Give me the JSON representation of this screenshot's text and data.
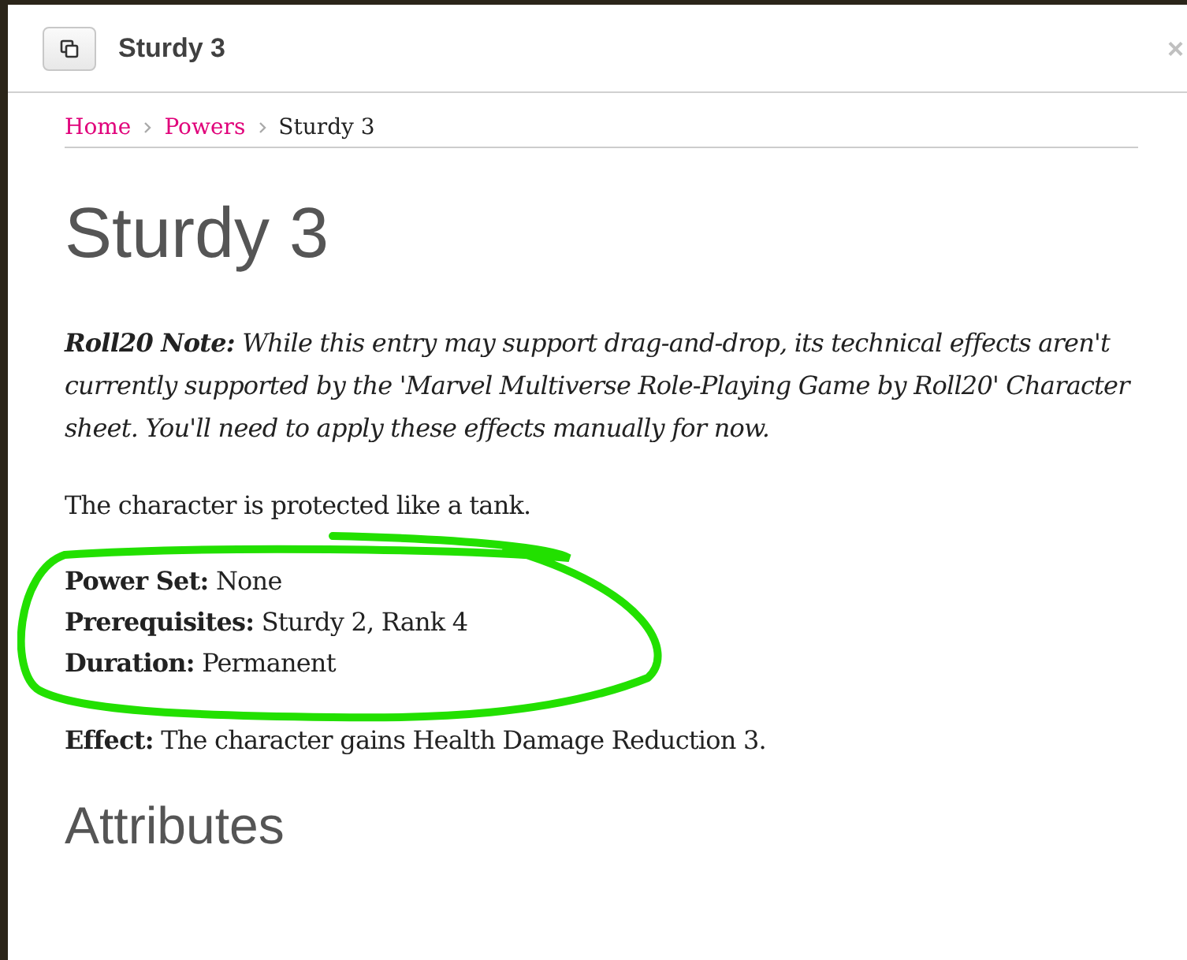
{
  "dialog": {
    "title": "Sturdy 3",
    "close": "×"
  },
  "breadcrumb": [
    {
      "label": "Home",
      "link": true
    },
    {
      "label": "Powers",
      "link": true
    },
    {
      "label": "Sturdy 3",
      "link": false
    }
  ],
  "heading": "Sturdy 3",
  "note": "**Roll20 Note:** While this entry may support drag-and-drop, its technical effects aren't currently supported by the 'Marvel Multiverse Role-Playing Game by Roll20' Character sheet. You'll need to apply these effects manually for now.",
  "description": "The character is protected like a tank.",
  "properties": [
    {
      "label": "Power Set:",
      "value": "None"
    },
    {
      "label": "Prerequisites:",
      "value": "Sturdy 2, Rank 4"
    },
    {
      "label": "Duration:",
      "value": "Permanent"
    }
  ],
  "effect": {
    "label": "Effect:",
    "value": "The character gains Health Damage Reduction 3."
  },
  "section": "Attributes"
}
